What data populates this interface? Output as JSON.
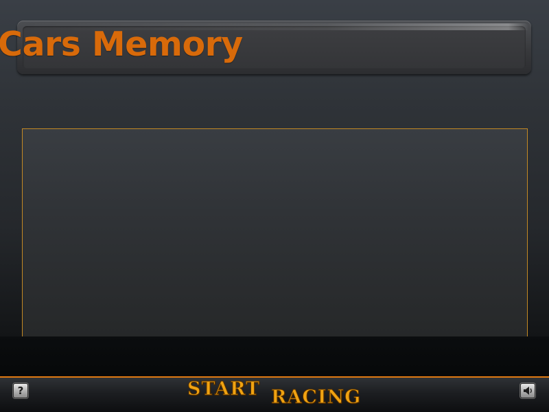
{
  "game": {
    "title": "Cars Memory"
  },
  "footer": {
    "start_word": "START",
    "racing_word": "RACING",
    "help_glyph": "?",
    "help_icon": "question-mark-icon",
    "sound_icon": "speaker-icon"
  },
  "colors": {
    "accent_orange": "#d86a0a",
    "button_gold": "#f0a312",
    "board_border": "#c58a24",
    "background_top": "#3a3f46",
    "background_bottom": "#050708"
  }
}
